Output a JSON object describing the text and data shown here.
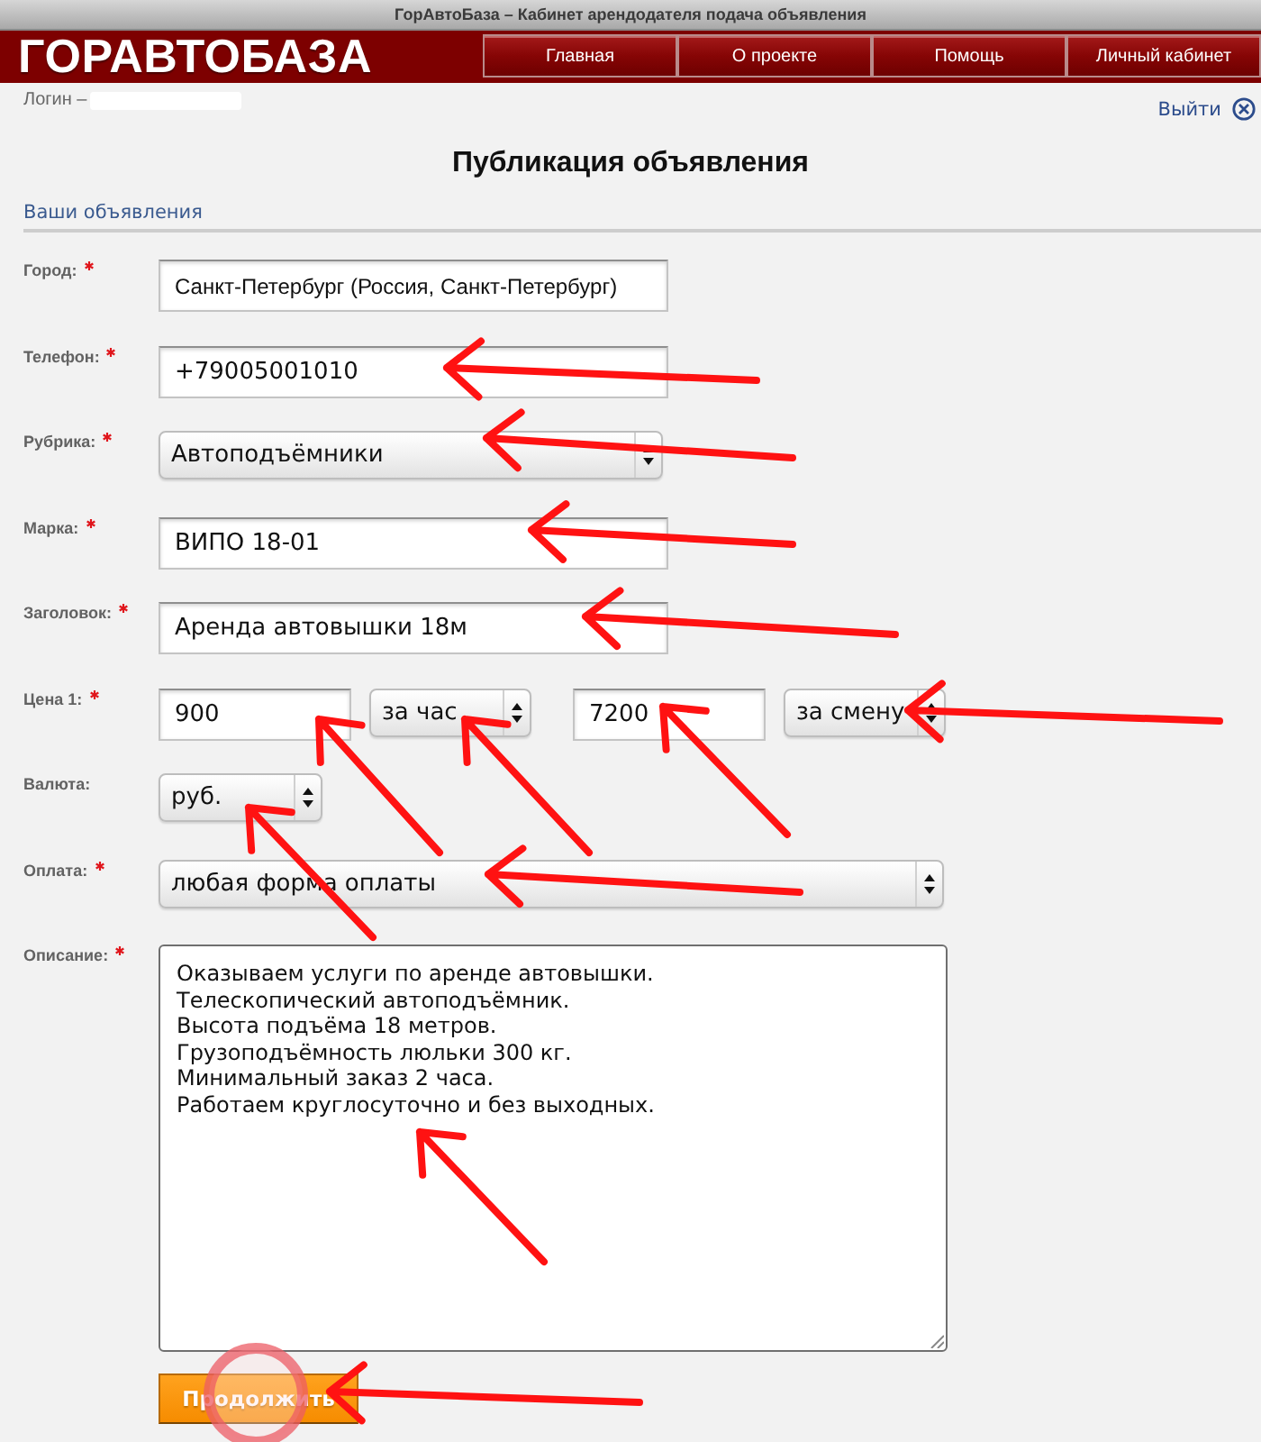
{
  "window": {
    "title": "ГорАвтоБаза – Кабинет арендодателя подача объявления"
  },
  "header": {
    "logo": "ГОРАВТОБАЗА",
    "nav": [
      {
        "label": "Главная"
      },
      {
        "label": "О проекте"
      },
      {
        "label": "Помощь"
      },
      {
        "label": "Личный кабинет"
      }
    ]
  },
  "user_bar": {
    "login_label": "Логин –",
    "logout_label": "Выйти"
  },
  "page_title": "Публикация объявления",
  "section_title": "Ваши объявления",
  "form": {
    "rows": [
      {
        "label": "Город:",
        "required": true,
        "controls": [
          {
            "kind": "input",
            "value": "Санкт-Петербург (Россия, Санкт-Петербург)"
          }
        ]
      },
      {
        "label": "Телефон:",
        "required": true,
        "controls": [
          {
            "kind": "input",
            "value": "+79005001010"
          }
        ]
      },
      {
        "label": "Рубрика:",
        "required": true,
        "controls": [
          {
            "kind": "select",
            "value": "Автоподъёмники"
          }
        ]
      },
      {
        "label": "Марка:",
        "required": true,
        "controls": [
          {
            "kind": "input",
            "value": "ВИПО 18-01"
          }
        ]
      },
      {
        "label": "Заголовок:",
        "required": true,
        "controls": [
          {
            "kind": "input",
            "value": "Аренда автовышки 18м"
          }
        ]
      },
      {
        "label": "Цена 1:",
        "required": true,
        "controls": [
          {
            "kind": "input",
            "value": "900"
          },
          {
            "kind": "select",
            "value": "за час"
          },
          {
            "kind": "input",
            "value": "7200"
          },
          {
            "kind": "select",
            "value": "за смену"
          }
        ]
      },
      {
        "label": "Валюта:",
        "required": false,
        "controls": [
          {
            "kind": "select",
            "value": "руб."
          }
        ]
      },
      {
        "label": "Оплата:",
        "required": true,
        "controls": [
          {
            "kind": "select",
            "value": "любая форма оплаты"
          }
        ]
      },
      {
        "label": "Описание:",
        "required": true,
        "controls": [
          {
            "kind": "textarea",
            "lines": [
              "Оказываем услуги по аренде автовышки.",
              "Телескопический автоподъёмник.",
              "Высота подъёма 18 метров.",
              "Грузоподъёмность люльки 300 кг.",
              "Минимальный заказ 2 часа.",
              "Работаем круглосуточно и без выходных."
            ]
          }
        ]
      }
    ]
  },
  "submit": {
    "label": "Продолжить"
  }
}
